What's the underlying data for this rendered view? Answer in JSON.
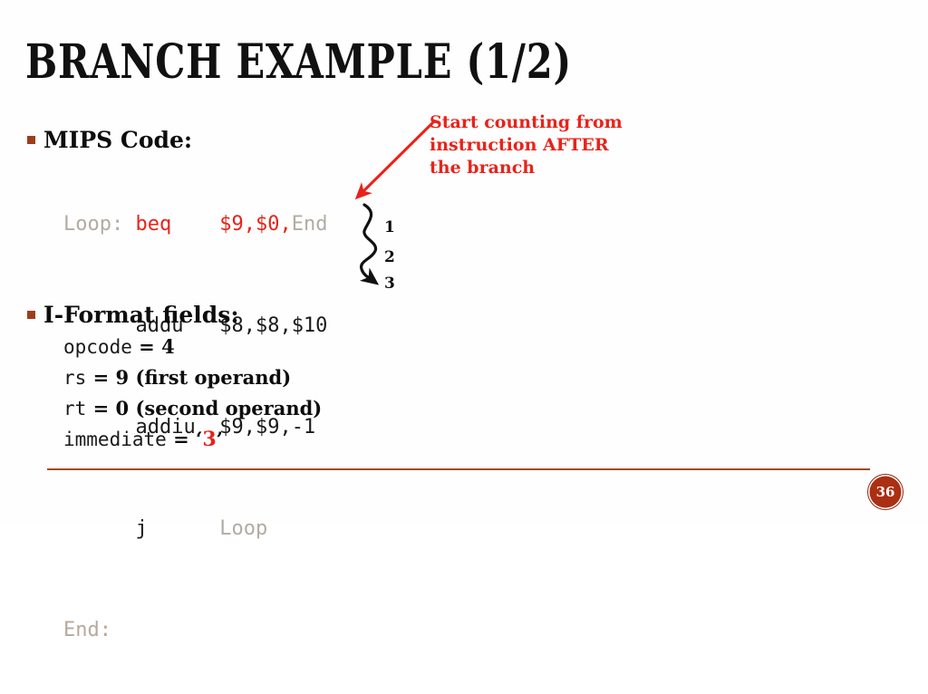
{
  "slide": {
    "title": "BRANCH EXAMPLE (1/2)",
    "page_number": "36"
  },
  "bullets": {
    "mips_code": "MIPS Code:",
    "iformat_fields": "I-Format fields:"
  },
  "code": {
    "lines": [
      {
        "label": "Loop:",
        "gap1": " ",
        "mnemonic": "beq",
        "gap2": "    ",
        "operands_red": "$9,$0,",
        "operands_gray": "End"
      },
      {
        "label": "      ",
        "mnemonic": "addu",
        "gap2": "   ",
        "operands": "$8,$8,$10"
      },
      {
        "label": "      ",
        "mnemonic": "addiu",
        "gap2": "  ",
        "operands": "$9,$9,-1"
      },
      {
        "label": "      ",
        "mnemonic": "j",
        "gap2": "      ",
        "operands": "Loop"
      },
      {
        "label": "End:"
      }
    ]
  },
  "fields": [
    {
      "name": "opcode",
      "rest": " = 4"
    },
    {
      "name": "rs",
      "rest": " = 9 (first operand)"
    },
    {
      "name": "rt",
      "rest": " = 0 (second operand)"
    },
    {
      "name": "immediate",
      "prefix": " = ‘",
      "value": "3",
      "suffix": "’"
    }
  ],
  "annotation": {
    "text": "Start counting from instruction AFTER the branch"
  },
  "counts": {
    "one": "1",
    "two": "2",
    "three": "3"
  },
  "colors": {
    "accent_red": "#e8231a",
    "brand_rust": "#ab2f13",
    "rule": "#a14a22",
    "code_label_gray": "#b2aca4"
  }
}
